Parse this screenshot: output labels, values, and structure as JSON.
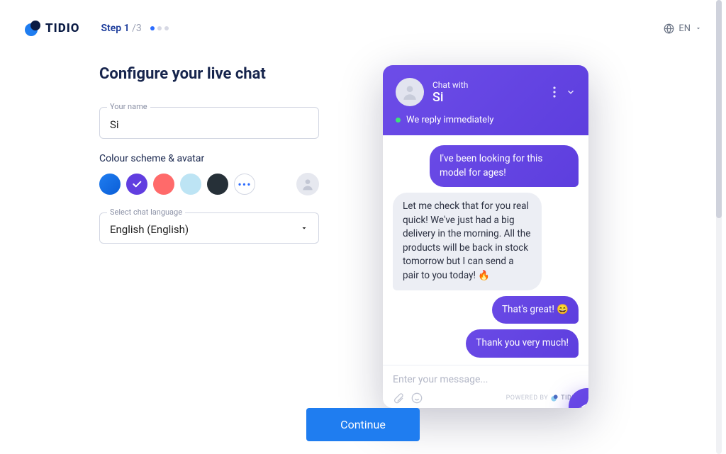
{
  "header": {
    "brand": "TIDIO",
    "step_current": "Step 1",
    "step_total": " /3",
    "lang": "EN"
  },
  "form": {
    "title": "Configure your live chat",
    "name_label": "Your name",
    "name_value": "Si",
    "color_section": "Colour scheme & avatar",
    "more_dots": "•••",
    "lang_label": "Select chat language",
    "lang_value": "English (English)",
    "colors": {
      "blue": "#1f7df0",
      "purple": "#613ee0",
      "coral": "#ff6a6a",
      "sky": "#bde4f4",
      "charcoal": "#263038"
    }
  },
  "preview": {
    "chat_with": "Chat with",
    "chat_name": "Si",
    "reply_text": "We reply immediately",
    "messages": {
      "m1": "I've been looking for this model for ages!",
      "m2": "Let me check that for you real quick! We've just had a big delivery in the morning. All the products will be back in stock tomorrow but I can send a pair to you today! 🔥",
      "m3": "That's great! 😄",
      "m4": "Thank you very much!"
    },
    "input_placeholder": "Enter your message...",
    "powered_prefix": "POWERED BY",
    "powered_brand": "TIDIO"
  },
  "footer": {
    "continue": "Continue"
  }
}
